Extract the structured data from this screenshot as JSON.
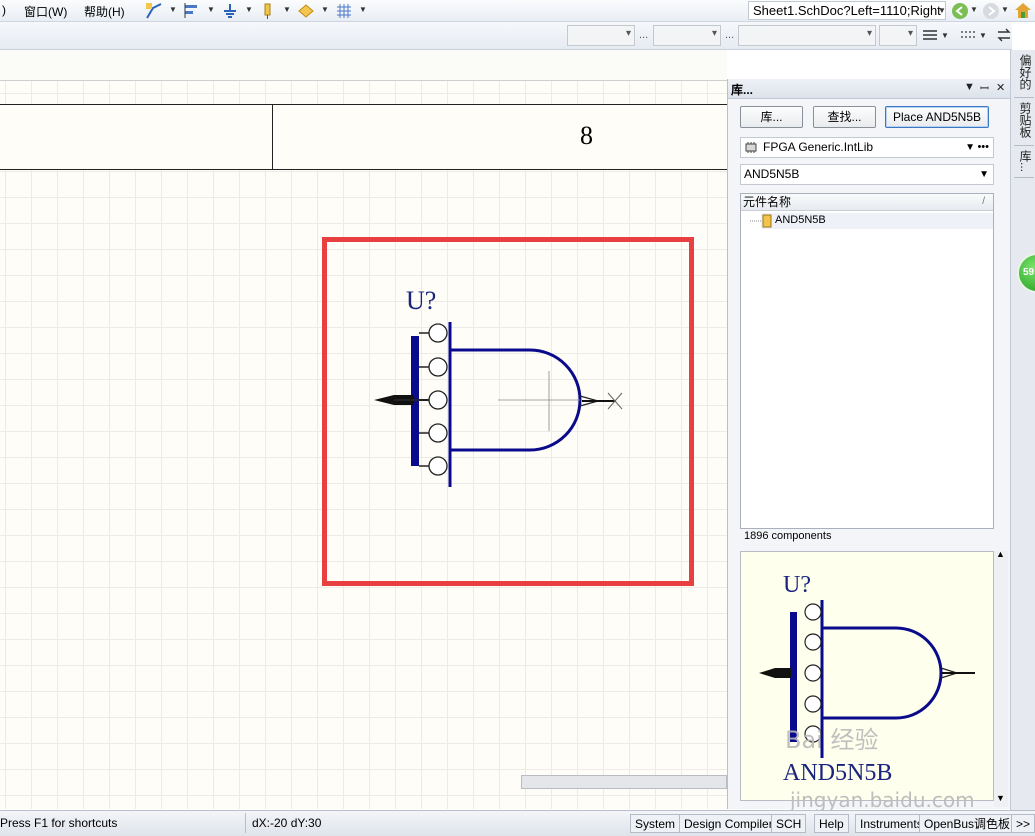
{
  "menu": {
    "paren_label": ")",
    "window_label": "窗口(W)",
    "help_label": "帮助(H)",
    "doc_url": "Sheet1.SchDoc?Left=1110;Right"
  },
  "sheet": {
    "zone_number": "8"
  },
  "component": {
    "designator": "U?",
    "name": "AND5N5B"
  },
  "panel": {
    "title": "库...",
    "buttons": {
      "library": "库...",
      "search": "查找...",
      "place": "Place AND5N5B"
    },
    "library_select": "FPGA Generic.IntLib",
    "filter_value": "AND5N5B",
    "column_header": "元件名称",
    "rows": [
      "AND5N5B"
    ],
    "count": "1896 components"
  },
  "side_tabs": [
    "偏好的",
    "剪贴板",
    "库..."
  ],
  "badge": "59",
  "status": {
    "hint": "Press F1 for shortcuts",
    "coords": "dX:-20 dY:30",
    "tabs": [
      "System",
      "Design Compiler",
      "SCH",
      "Help",
      "Instruments",
      "OpenBus调色板",
      ">>"
    ]
  },
  "watermark": {
    "line1": "Bai 经验",
    "line2": "jingyan.baidu.com"
  }
}
